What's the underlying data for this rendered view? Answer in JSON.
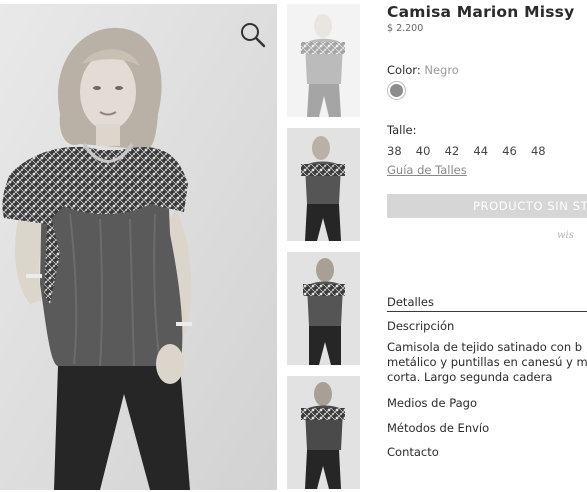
{
  "product": {
    "title": "Camisa Marion Missy",
    "price": "$ 2.200",
    "color_label": "Color:",
    "color_value": "Negro",
    "swatch_color": "#8c8c8c",
    "size_label": "Talle:",
    "sizes": [
      "38",
      "40",
      "42",
      "44",
      "46",
      "48"
    ],
    "size_guide": "Guía de Talles",
    "no_stock_button": "PRODUCTO SIN STOCK",
    "wishlist": "wis"
  },
  "details": {
    "heading": "Detalles",
    "description_heading": "Descripción",
    "description_lines": [
      "Camisola de tejido satinado con b",
      "metálico y puntillas en canesú y m",
      "corta. Largo segunda cadera"
    ],
    "payment": "Medios de Pago",
    "shipping": "Métodos de Envío",
    "contact": "Contacto"
  },
  "gallery": {
    "zoom_icon": "magnifier-icon",
    "thumbnails": [
      "front-faded",
      "front",
      "back-side",
      "back"
    ]
  }
}
